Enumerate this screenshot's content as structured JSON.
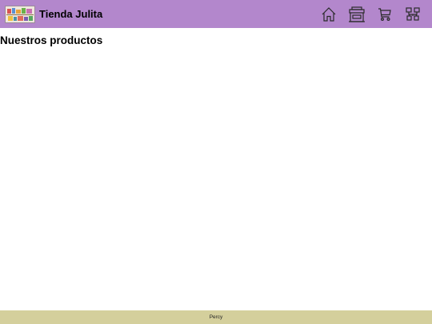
{
  "header": {
    "brand_name": "Tienda Julita",
    "logo_alt": "Tienda Julita",
    "nav": [
      {
        "icon": "home-icon"
      },
      {
        "icon": "store-icon"
      },
      {
        "icon": "cart-icon"
      },
      {
        "icon": "network-icon"
      }
    ]
  },
  "main": {
    "title": "Nuestros productos"
  },
  "footer": {
    "text": "Percy"
  },
  "colors": {
    "header_bg": "#b387cc",
    "footer_bg": "#d4cf9c"
  }
}
